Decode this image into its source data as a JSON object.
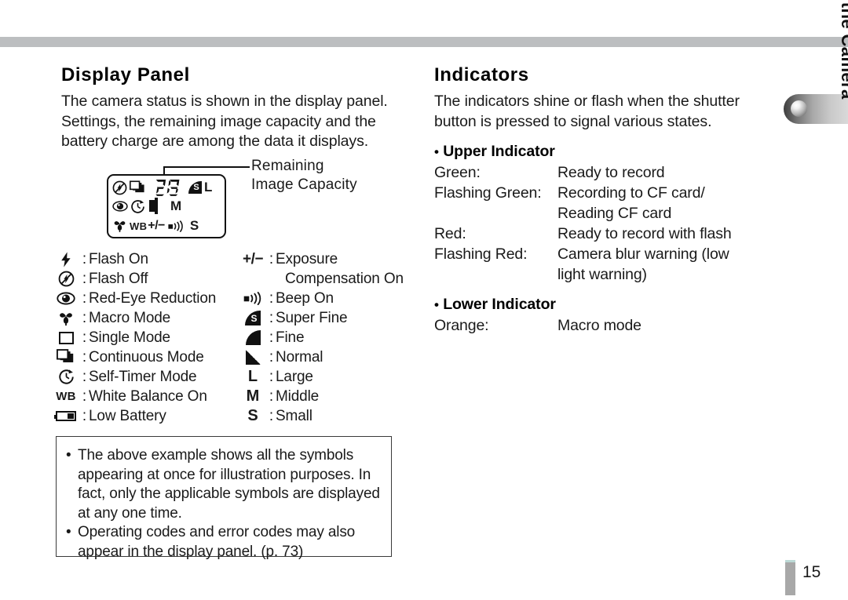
{
  "page": {
    "number": "15",
    "side_tab_label": "Preparing the Camera"
  },
  "left_section": {
    "title": "Display Panel",
    "intro": "The camera status is shown in the display panel. Settings, the remaining image capacity and the battery charge are among the data it displays.",
    "diagram": {
      "callout_label": "Remaining Image Capacity",
      "lcd_value": "28",
      "lcd_icons_row1": [
        "flash-off",
        "continuous-mode",
        "digits-28",
        "super-fine",
        "L"
      ],
      "lcd_icons_row2": [
        "red-eye-reduction",
        "self-timer",
        "low-battery",
        "fine",
        "M"
      ],
      "lcd_icons_row3": [
        "macro-mode",
        "WB",
        "+/-",
        "beep-on",
        "normal",
        "S"
      ]
    },
    "legend_left": [
      {
        "icon": "flash-on",
        "text": "Flash On"
      },
      {
        "icon": "flash-off",
        "text": "Flash Off"
      },
      {
        "icon": "red-eye",
        "text": "Red-Eye Reduction"
      },
      {
        "icon": "macro",
        "text": "Macro Mode"
      },
      {
        "icon": "single-mode",
        "text": "Single Mode"
      },
      {
        "icon": "continuous-mode",
        "text": "Continuous Mode"
      },
      {
        "icon": "self-timer",
        "text": "Self-Timer Mode"
      },
      {
        "icon": "white-balance",
        "text": "White Balance On"
      },
      {
        "icon": "low-battery",
        "text": "Low Battery"
      }
    ],
    "legend_right": [
      {
        "icon": "exposure-comp",
        "text": "Exposure",
        "cont": "Compensation On"
      },
      {
        "icon": "beep",
        "text": "Beep On",
        "cont": ""
      },
      {
        "icon": "super-fine",
        "text": "Super Fine",
        "cont": ""
      },
      {
        "icon": "fine",
        "text": "Fine",
        "cont": ""
      },
      {
        "icon": "normal",
        "text": "Normal",
        "cont": ""
      },
      {
        "icon": "size-large",
        "text": "Large",
        "cont": ""
      },
      {
        "icon": "size-middle",
        "text": "Middle",
        "cont": ""
      },
      {
        "icon": "size-small",
        "text": "Small",
        "cont": ""
      }
    ],
    "note": {
      "items": [
        "The above example shows all the symbols appearing at once for illustration purposes. In fact, only the applicable symbols are displayed at any one time.",
        "Operating codes and error codes may also appear in the display panel. (p. 73)"
      ],
      "bullet": "•"
    }
  },
  "right_section": {
    "title": "Indicators",
    "intro": "The indicators shine or flash when the shutter button is pressed to signal various states.",
    "upper_heading": "Upper Indicator",
    "lower_heading": "Lower Indicator",
    "bullet": "•",
    "upper_rows": [
      {
        "label": "Green:",
        "value": "Ready to record",
        "cont": ""
      },
      {
        "label": "Flashing Green:",
        "value": "Recording to CF card/",
        "cont": "Reading CF card"
      },
      {
        "label": "Red:",
        "value": "Ready to record with flash",
        "cont": ""
      },
      {
        "label": "Flashing Red:",
        "value": "Camera blur warning (low",
        "cont": "light warning)"
      }
    ],
    "lower_rows": [
      {
        "label": "Orange:",
        "value": "Macro mode",
        "cont": ""
      }
    ]
  },
  "colors": {
    "rule_gray": "#bcbec0",
    "page_marker_gray": "#a8a8a8",
    "page_marker_cap": "#bcd9d6",
    "ink": "#1a1a1a"
  }
}
